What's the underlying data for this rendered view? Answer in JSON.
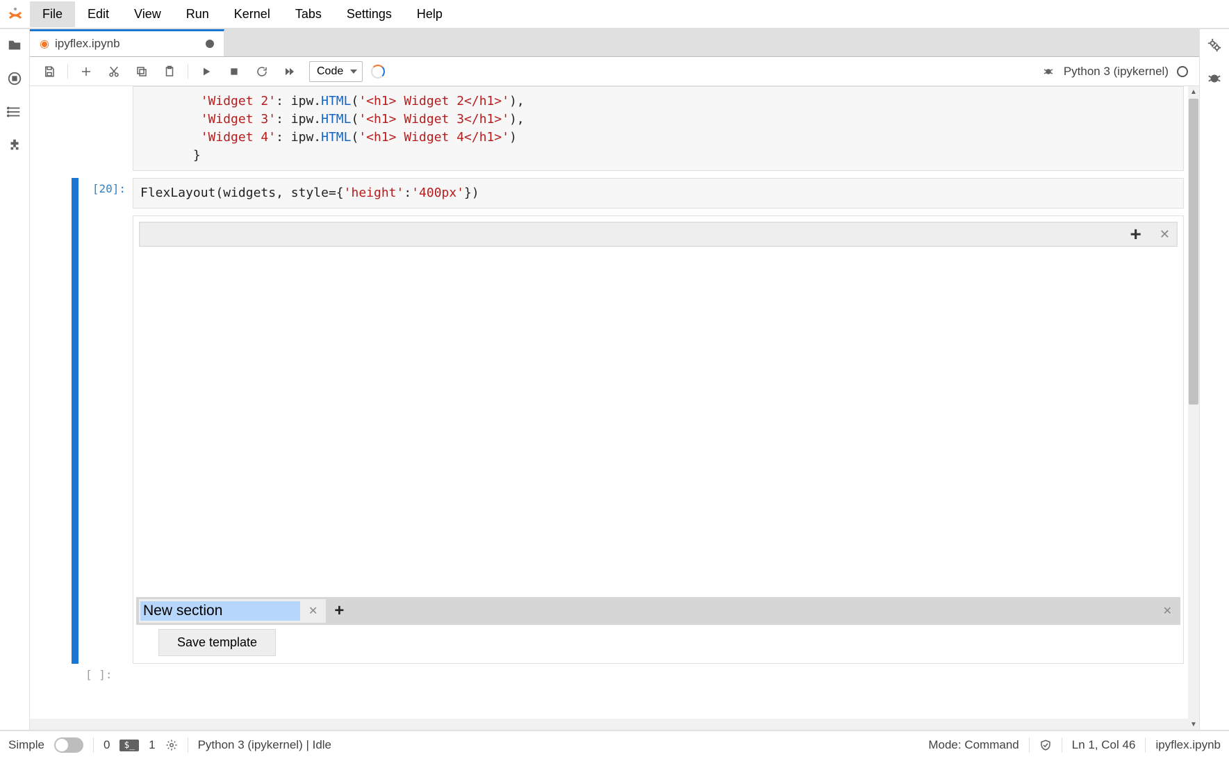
{
  "menu": [
    "File",
    "Edit",
    "View",
    "Run",
    "Kernel",
    "Tabs",
    "Settings",
    "Help"
  ],
  "menu_active": "File",
  "tab": {
    "label": "ipyflex.ipynb",
    "dirty": true
  },
  "left_rail": [
    "folder-icon",
    "running-icon",
    "toc-icon",
    "extensions-icon"
  ],
  "right_rail": [
    "property-inspector-icon",
    "debugger-sidebar-icon"
  ],
  "toolbar": {
    "cell_type": "Code",
    "kernel_name": "Python 3 (ipykernel)"
  },
  "cells": {
    "prev_fragment": {
      "lines": [
        {
          "key": "'Widget 2'",
          "pre": "ipw.",
          "func": "HTML",
          "arg": "'<h1> Widget 2</h1>'",
          "trail": ","
        },
        {
          "key": "'Widget 3'",
          "pre": "ipw.",
          "func": "HTML",
          "arg": "'<h1> Widget 3</h1>'",
          "trail": ","
        },
        {
          "key": "'Widget 4'",
          "pre": "ipw.",
          "func": "HTML",
          "arg": "'<h1> Widget 4</h1>'",
          "trail": ""
        }
      ],
      "close": "}"
    },
    "exec": {
      "prompt": "[20]:",
      "call": "FlexLayout",
      "args_a": "widgets",
      "args_b_key": "style",
      "args_b_dict_k": "'height'",
      "args_b_dict_v": "'400px'"
    }
  },
  "flex": {
    "section_name": "New section",
    "save_template": "Save template"
  },
  "empty_prompt": "[ ]:",
  "statusbar": {
    "simple": "Simple",
    "err_count": "0",
    "term_badge": "$_",
    "term_count": "1",
    "kernel": "Python 3 (ipykernel) | Idle",
    "mode": "Mode: Command",
    "pos": "Ln 1, Col 46",
    "file": "ipyflex.ipynb"
  }
}
